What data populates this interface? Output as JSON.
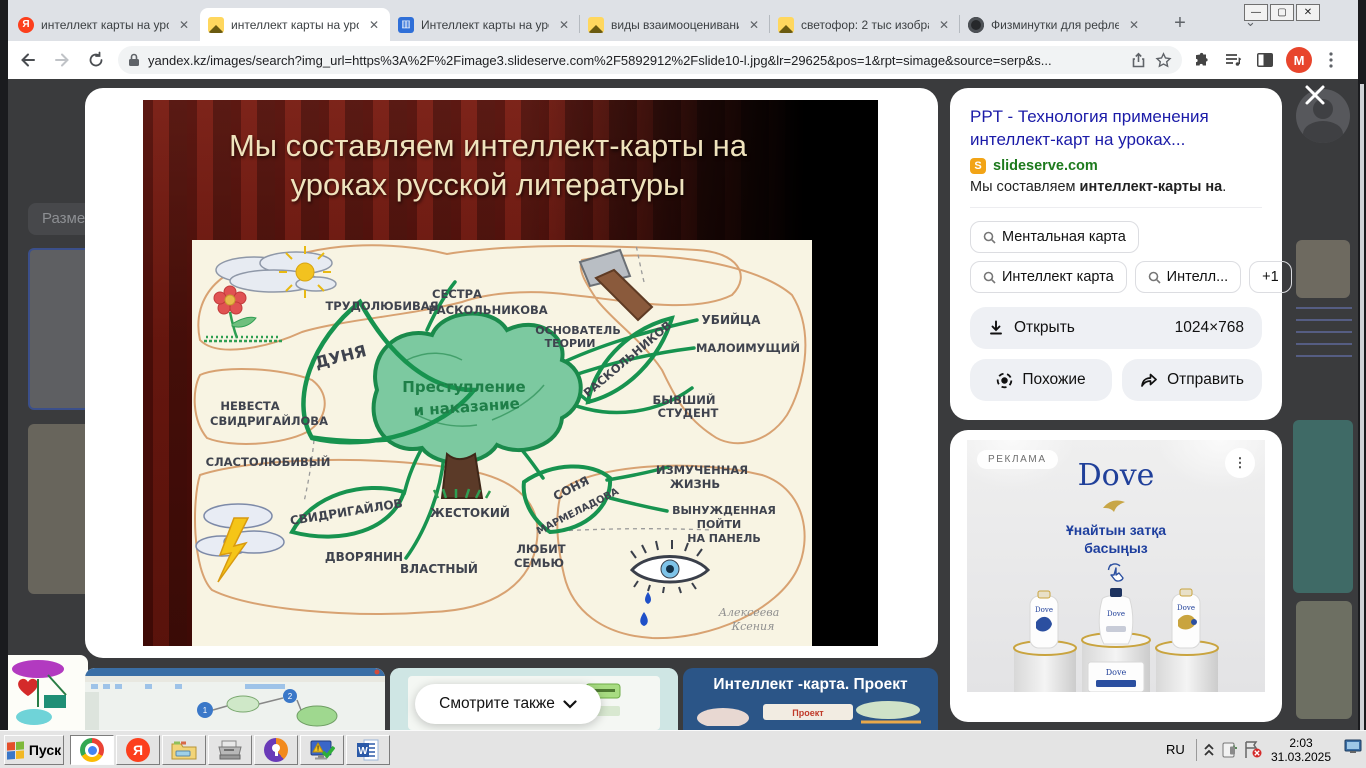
{
  "browser": {
    "tabs": [
      {
        "title": "интеллект карты на уро"
      },
      {
        "title": "интеллект карты на уро"
      },
      {
        "title": "Интеллект карты на уро"
      },
      {
        "title": "виды взаимооценивани"
      },
      {
        "title": "светофор: 2 тыс изобра"
      },
      {
        "title": "Физминутки для рефлек"
      }
    ],
    "new_tab": "+",
    "url": "yandex.kz/images/search?img_url=https%3A%2F%2Fimage3.slideserve.com%2F5892912%2Fslide10-l.jpg&lr=29625&pos=1&rpt=simage&source=serp&s...",
    "profile_initial": "M"
  },
  "viewer": {
    "slide": {
      "title_line1": "Мы составляем интеллект-карты на",
      "title_line2": "уроках русской литературы"
    },
    "mindmap": {
      "center1": "Преступление",
      "center2": "и наказание",
      "labels": {
        "trudolyubivaya": "ТРУДОЛЮБИВАЯ",
        "sestra1": "СЕСТРА",
        "sestra2": "РАСКОЛЬНИКОВА",
        "dunya": "ДУНЯ",
        "osnovatel1": "ОСНОВАТЕЛЬ",
        "osnovatel2": "ТЕОРИИ",
        "raskolnikov": "РАСКОЛЬНИКОВ",
        "ubiytsa": "УБИЙЦА",
        "maloimushchiy": "МАЛОИМУЩИЙ",
        "byvshiy1": "БЫВШИЙ",
        "byvshiy2": "СТУДЕНТ",
        "nevesta1": "НЕВЕСТА",
        "nevesta2": "СВИДРИГАЙЛОВА",
        "slastolyubivyy": "СЛАСТОЛЮБИВЫЙ",
        "svidrigaylov": "СВИДРИГАЙЛОВ",
        "zhestokiy": "ЖЕСТОКИЙ",
        "dvoryanin": "ДВОРЯНИН",
        "vlastnyy": "ВЛАСТНЫЙ",
        "sonya1": "СОНЯ",
        "sonya2": "МАРМЕЛАДОВА",
        "lyubit1": "ЛЮБИТ",
        "lyubit2": "СЕМЬЮ",
        "izmuchennaya1": "ИЗМУЧЕННАЯ",
        "izmuchennaya2": "ЖИЗНЬ",
        "vynuzhdennaya1": "ВЫНУЖДЕННАЯ",
        "vynuzhdennaya2": "ПОЙТИ",
        "vynuzhdennaya3": "НА ПАНЕЛЬ"
      },
      "signature1": "Алексеева",
      "signature2": "Ксения"
    },
    "see_also": "Смотрите также",
    "thumb3_title": "Интеллект -карта. Проект"
  },
  "panel": {
    "title": "PPT - Технология применения интеллект-карт на уроках...",
    "source_badge": "S",
    "source": "slideserve.com",
    "snippet_pre": "Мы составляем ",
    "snippet_bold": "интеллект-карты на",
    "snippet_post": ".",
    "chips": [
      "Ментальная карта",
      "Интеллект карта",
      "Интелл...",
      "+1"
    ],
    "open_label": "Открыть",
    "resolution": "1024×768",
    "similar_label": "Похожие",
    "send_label": "Отправить"
  },
  "ad": {
    "badge": "РЕКЛАМА",
    "brand": "Dove",
    "line1": "Ұнайтын затқа",
    "line2": "басыңыз"
  },
  "page_left": {
    "filter": "Разме"
  },
  "taskbar": {
    "start": "Пуск",
    "lang": "RU",
    "time": "2:03",
    "date": "31.03.2025"
  }
}
